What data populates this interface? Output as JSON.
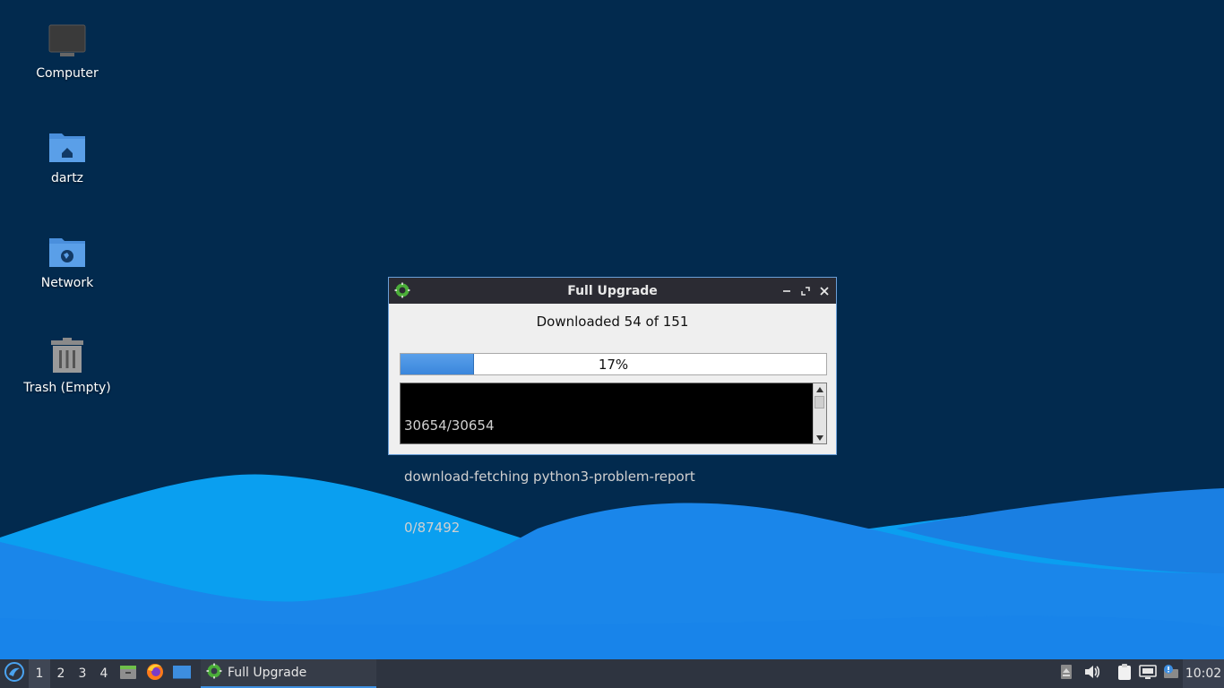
{
  "desktop": {
    "icons": [
      {
        "label": "Computer",
        "icon": "computer-icon"
      },
      {
        "label": "dartz",
        "icon": "home-folder-icon"
      },
      {
        "label": "Network",
        "icon": "network-folder-icon"
      },
      {
        "label": "Trash (Empty)",
        "icon": "trash-icon"
      }
    ]
  },
  "dialog": {
    "title": "Full Upgrade",
    "status": "Downloaded 54 of 151",
    "progress_percent": 17,
    "progress_label": "17%",
    "log_lines": [
      "30654/30654",
      "download-fetching python3-problem-report",
      "0/87492"
    ]
  },
  "taskbar": {
    "workspaces": [
      "1",
      "2",
      "3",
      "4"
    ],
    "active_workspace": "1",
    "launchers": [
      "file-manager-icon",
      "firefox-icon",
      "desktop-icon"
    ],
    "window_button_label": "Full Upgrade",
    "clock": "10:02"
  },
  "colors": {
    "desktop_bg": "#022a4e",
    "wave_light": "#0aa6f2",
    "wave_mid": "#1b8ff0",
    "taskbar_bg": "#2e3440",
    "progress_fill": "#3a86dc"
  }
}
